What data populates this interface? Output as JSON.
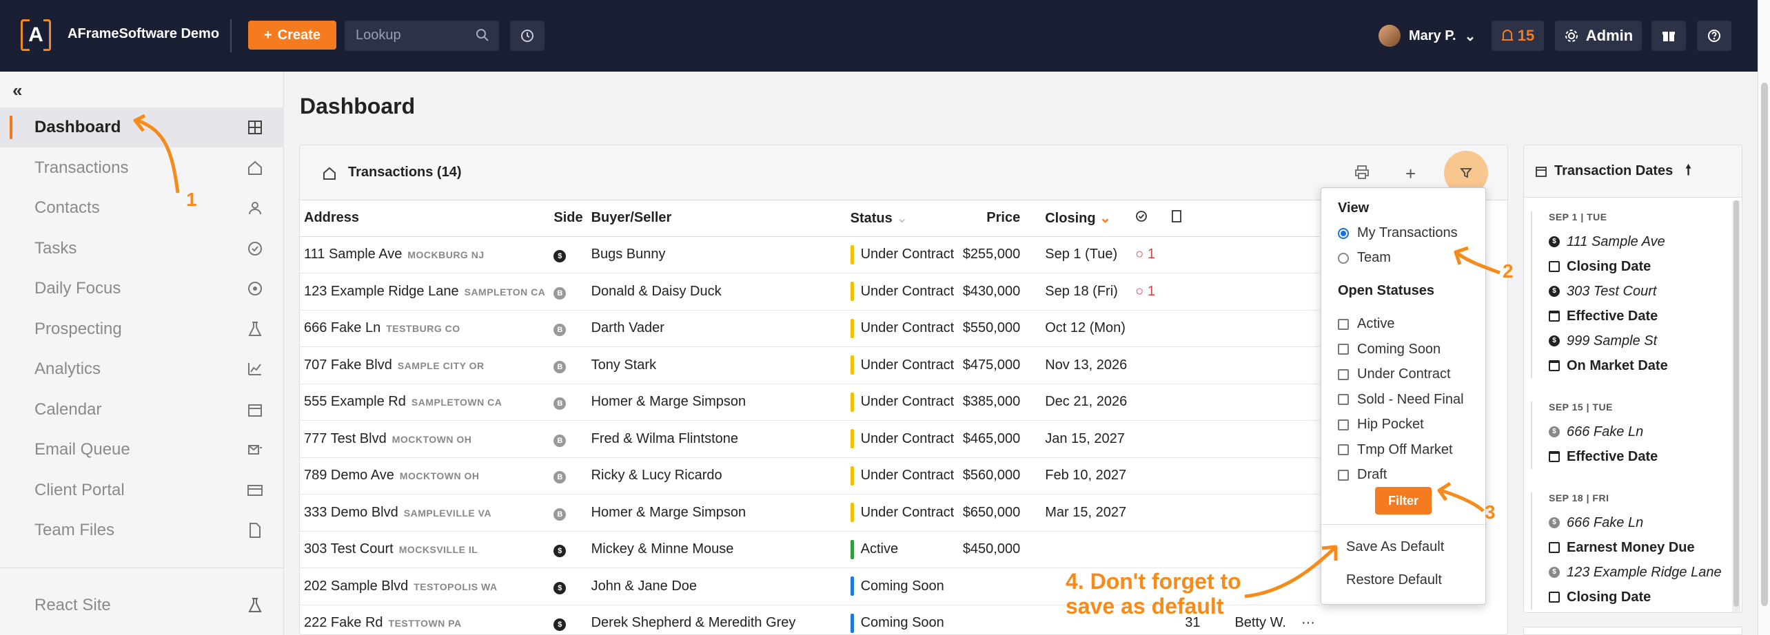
{
  "topbar": {
    "brand": "AFrameSoftware Demo",
    "logo_letter": "A",
    "create_label": "Create",
    "lookup_placeholder": "Lookup",
    "user_name": "Mary P.",
    "notifications": "15",
    "admin_label": "Admin"
  },
  "sidebar": {
    "items": [
      {
        "label": "Dashboard",
        "icon": "grid-icon",
        "active": true
      },
      {
        "label": "Transactions",
        "icon": "home-icon"
      },
      {
        "label": "Contacts",
        "icon": "user-icon"
      },
      {
        "label": "Tasks",
        "icon": "check-circle-icon"
      },
      {
        "label": "Daily Focus",
        "icon": "target-icon"
      },
      {
        "label": "Prospecting",
        "icon": "flask-icon"
      },
      {
        "label": "Analytics",
        "icon": "chart-icon"
      },
      {
        "label": "Calendar",
        "icon": "calendar-icon"
      },
      {
        "label": "Email Queue",
        "icon": "email-queue-icon"
      },
      {
        "label": "Client Portal",
        "icon": "card-icon"
      },
      {
        "label": "Team Files",
        "icon": "file-icon"
      }
    ],
    "bottom_item": {
      "label": "React Site",
      "icon": "flask-icon"
    }
  },
  "page_title": "Dashboard",
  "transactions": {
    "title": "Transactions (14)",
    "columns": [
      "Address",
      "Side",
      "Buyer/Seller",
      "Status",
      "Price",
      "Closing"
    ],
    "rows": [
      {
        "address": "111 Sample Ave",
        "city": "MOCKBURG NJ",
        "side": "$",
        "side_dark": true,
        "party": "Bugs Bunny",
        "status": "Under Contract",
        "status_color": "#f2c200",
        "price": "$255,000",
        "closing": "Sep 1 (Tue)",
        "alert": "1"
      },
      {
        "address": "123 Example Ridge Lane",
        "city": "SAMPLETON CA",
        "side": "B",
        "side_dark": false,
        "party": "Donald & Daisy Duck",
        "status": "Under Contract",
        "status_color": "#f2c200",
        "price": "$430,000",
        "closing": "Sep 18 (Fri)",
        "alert": "1"
      },
      {
        "address": "666 Fake Ln",
        "city": "TESTBURG CO",
        "side": "B",
        "side_dark": false,
        "party": "Darth Vader",
        "status": "Under Contract",
        "status_color": "#f2c200",
        "price": "$550,000",
        "closing": "Oct 12 (Mon)",
        "alert": ""
      },
      {
        "address": "707 Fake Blvd",
        "city": "SAMPLE CITY OR",
        "side": "B",
        "side_dark": false,
        "party": "Tony Stark",
        "status": "Under Contract",
        "status_color": "#f2c200",
        "price": "$475,000",
        "closing": "Nov 13, 2026",
        "alert": ""
      },
      {
        "address": "555 Example Rd",
        "city": "SAMPLETOWN CA",
        "side": "B",
        "side_dark": false,
        "party": "Homer & Marge Simpson",
        "status": "Under Contract",
        "status_color": "#f2c200",
        "price": "$385,000",
        "closing": "Dec 21, 2026",
        "alert": ""
      },
      {
        "address": "777 Test Blvd",
        "city": "MOCKTOWN OH",
        "side": "B",
        "side_dark": false,
        "party": "Fred & Wilma Flintstone",
        "status": "Under Contract",
        "status_color": "#f2c200",
        "price": "$465,000",
        "closing": "Jan 15, 2027",
        "alert": ""
      },
      {
        "address": "789 Demo Ave",
        "city": "MOCKTOWN OH",
        "side": "B",
        "side_dark": false,
        "party": "Ricky & Lucy Ricardo",
        "status": "Under Contract",
        "status_color": "#f2c200",
        "price": "$560,000",
        "closing": "Feb 10, 2027",
        "alert": ""
      },
      {
        "address": "333 Demo Blvd",
        "city": "SAMPLEVILLE VA",
        "side": "B",
        "side_dark": false,
        "party": "Homer & Marge Simpson",
        "status": "Under Contract",
        "status_color": "#f2c200",
        "price": "$650,000",
        "closing": "Mar 15, 2027",
        "alert": ""
      },
      {
        "address": "303 Test Court",
        "city": "MOCKSVILLE IL",
        "side": "$",
        "side_dark": true,
        "party": "Mickey & Minne Mouse",
        "status": "Active",
        "status_color": "#2e9e3e",
        "price": "$450,000",
        "closing": "",
        "alert": ""
      },
      {
        "address": "202 Sample Blvd",
        "city": "TESTOPOLIS WA",
        "side": "$",
        "side_dark": true,
        "party": "John & Jane Doe",
        "status": "Coming Soon",
        "status_color": "#1a7ae0",
        "price": "",
        "closing": "",
        "alert": ""
      },
      {
        "address": "222 Fake Rd",
        "city": "TESTTOWN PA",
        "side": "$",
        "side_dark": true,
        "party": "Derek Shepherd & Meredith Grey",
        "status": "Coming Soon",
        "status_color": "#1a7ae0",
        "price": "",
        "closing": "",
        "alert": "",
        "extra_count": "31",
        "extra_agent": "Betty W."
      }
    ]
  },
  "filter_popup": {
    "view_title": "View",
    "view_options": [
      {
        "label": "My Transactions",
        "checked": true
      },
      {
        "label": "Team",
        "checked": false
      }
    ],
    "statuses_title": "Open Statuses",
    "statuses": [
      "Active",
      "Coming Soon",
      "Under Contract",
      "Sold - Need Final",
      "Hip Pocket",
      "Tmp Off Market",
      "Draft"
    ],
    "filter_label": "Filter",
    "save_default": "Save As Default",
    "restore_default": "Restore Default"
  },
  "dates_panel": {
    "title": "Transaction Dates",
    "groups": [
      {
        "date": "SEP 1 | TUE",
        "items": [
          {
            "text": "111 Sample Ave",
            "style": "it",
            "icon": "money"
          },
          {
            "text": "Closing Date",
            "style": "b",
            "icon": "box"
          },
          {
            "text": "303 Test Court",
            "style": "it",
            "icon": "money"
          },
          {
            "text": "Effective Date",
            "style": "b",
            "icon": "cal"
          },
          {
            "text": "999 Sample St",
            "style": "it",
            "icon": "money"
          },
          {
            "text": "On Market Date",
            "style": "b",
            "icon": "cal"
          }
        ]
      },
      {
        "date": "SEP 15 | TUE",
        "items": [
          {
            "text": "666 Fake Ln",
            "style": "it",
            "icon": "money-grey"
          },
          {
            "text": "Effective Date",
            "style": "b",
            "icon": "cal"
          }
        ]
      },
      {
        "date": "SEP 18 | FRI",
        "items": [
          {
            "text": "666 Fake Ln",
            "style": "it",
            "icon": "money-grey"
          },
          {
            "text": "Earnest Money Due",
            "style": "b",
            "icon": "box"
          },
          {
            "text": "123 Example Ridge Lane",
            "style": "it",
            "icon": "money-grey"
          },
          {
            "text": "Closing Date",
            "style": "b",
            "icon": "box"
          }
        ]
      }
    ]
  },
  "annotations": {
    "n1": "1",
    "n2": "2",
    "n3": "3",
    "n4_line1": "4. Don't forget to",
    "n4_line2": "save as default"
  },
  "colors": {
    "accent": "#f47b20",
    "topbar": "#1b1f33"
  }
}
